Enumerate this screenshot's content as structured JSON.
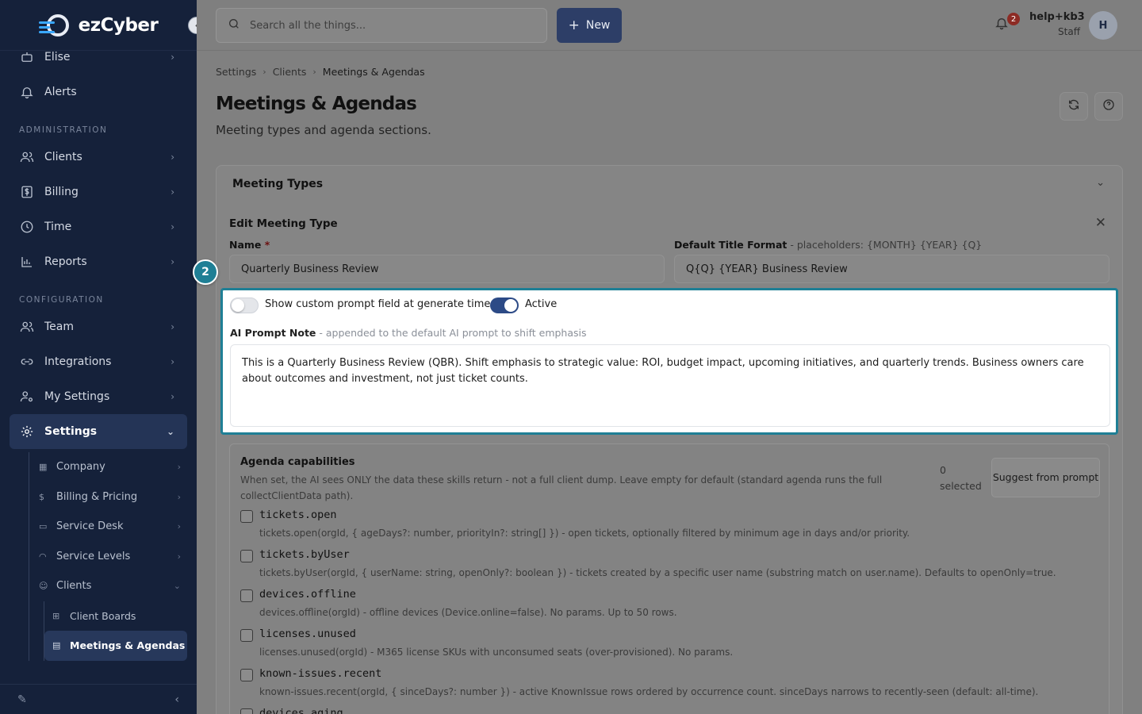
{
  "brand": {
    "name": "ezCyber"
  },
  "sidebar": {
    "top_items": [
      {
        "label": "Elise",
        "icon": "robot-icon"
      },
      {
        "label": "Alerts",
        "icon": "bell-icon"
      }
    ],
    "section_admin": "ADMINISTRATION",
    "admin_items": [
      {
        "label": "Clients",
        "icon": "users-icon"
      },
      {
        "label": "Billing",
        "icon": "dollar-icon"
      },
      {
        "label": "Time",
        "icon": "clock-icon"
      },
      {
        "label": "Reports",
        "icon": "chart-icon"
      }
    ],
    "section_config": "CONFIGURATION",
    "config_items": [
      {
        "label": "Team",
        "icon": "users-icon"
      },
      {
        "label": "Integrations",
        "icon": "link-icon"
      },
      {
        "label": "My Settings",
        "icon": "user-cog-icon"
      }
    ],
    "active_item": "Settings",
    "settings_sub": [
      {
        "label": "Company"
      },
      {
        "label": "Billing & Pricing"
      },
      {
        "label": "Service Desk"
      },
      {
        "label": "Service Levels"
      },
      {
        "label": "Clients"
      }
    ],
    "clients_sub": [
      {
        "label": "Client Boards"
      },
      {
        "label": "Meetings & Agendas"
      }
    ]
  },
  "topbar": {
    "search_placeholder": "Search all the things...",
    "new_label": "New",
    "notifications_count": "2",
    "user_name": "help+kb3",
    "user_role": "Staff",
    "avatar_initial": "H"
  },
  "breadcrumb": [
    "Settings",
    "Clients",
    "Meetings & Agendas"
  ],
  "page": {
    "title": "Meetings & Agendas",
    "subtitle": "Meeting types and agenda sections."
  },
  "meeting_types": {
    "header": "Meeting Types",
    "edit_title": "Edit Meeting Type",
    "name_label": "Name",
    "name_required": "*",
    "name_value": "Quarterly Business Review",
    "title_format_label": "Default Title Format",
    "title_format_hint": " - placeholders: {MONTH} {YEAR} {Q}",
    "title_format_value": "Q{Q} {YEAR} Business Review",
    "custom_prompt_toggle": {
      "label": "Show custom prompt field at generate time",
      "on": false
    },
    "active_toggle": {
      "label": "Active",
      "on": true
    },
    "ai_prompt_label": "AI Prompt Note",
    "ai_prompt_hint": " - appended to the default AI prompt to shift emphasis",
    "ai_prompt_value": "This is a Quarterly Business Review (QBR). Shift emphasis to strategic value: ROI, budget impact, upcoming initiatives, and quarterly trends. Business owners care about outcomes and investment, not just ticket counts."
  },
  "agenda": {
    "title": "Agenda capabilities",
    "description": "When set, the AI sees ONLY the data these skills return - not a full client dump. Leave empty for default (standard agenda runs the full collectClientData path).",
    "selected_count": "0",
    "selected_label": "selected",
    "suggest_label": "Suggest from prompt",
    "skills": [
      {
        "name": "tickets.open",
        "desc": "tickets.open(orgId, { ageDays?: number, priorityIn?: string[] }) - open tickets, optionally filtered by minimum age in days and/or priority."
      },
      {
        "name": "tickets.byUser",
        "desc": "tickets.byUser(orgId, { userName: string, openOnly?: boolean }) - tickets created by a specific user name (substring match on user.name). Defaults to openOnly=true."
      },
      {
        "name": "devices.offline",
        "desc": "devices.offline(orgId) - offline devices (Device.online=false). No params. Up to 50 rows."
      },
      {
        "name": "licenses.unused",
        "desc": "licenses.unused(orgId) - M365 license SKUs with unconsumed seats (over-provisioned). No params."
      },
      {
        "name": "known-issues.recent",
        "desc": "known-issues.recent(orgId, { sinceDays?: number }) - active KnownIssue rows ordered by occurrence count. sinceDays narrows to recently-seen (default: all-time)."
      },
      {
        "name": "devices.aging",
        "desc": ""
      }
    ]
  },
  "step_badge": "2",
  "colors": {
    "accent": "#1f7f95",
    "primary": "#2d3e67",
    "sidebar": "#15213a"
  }
}
